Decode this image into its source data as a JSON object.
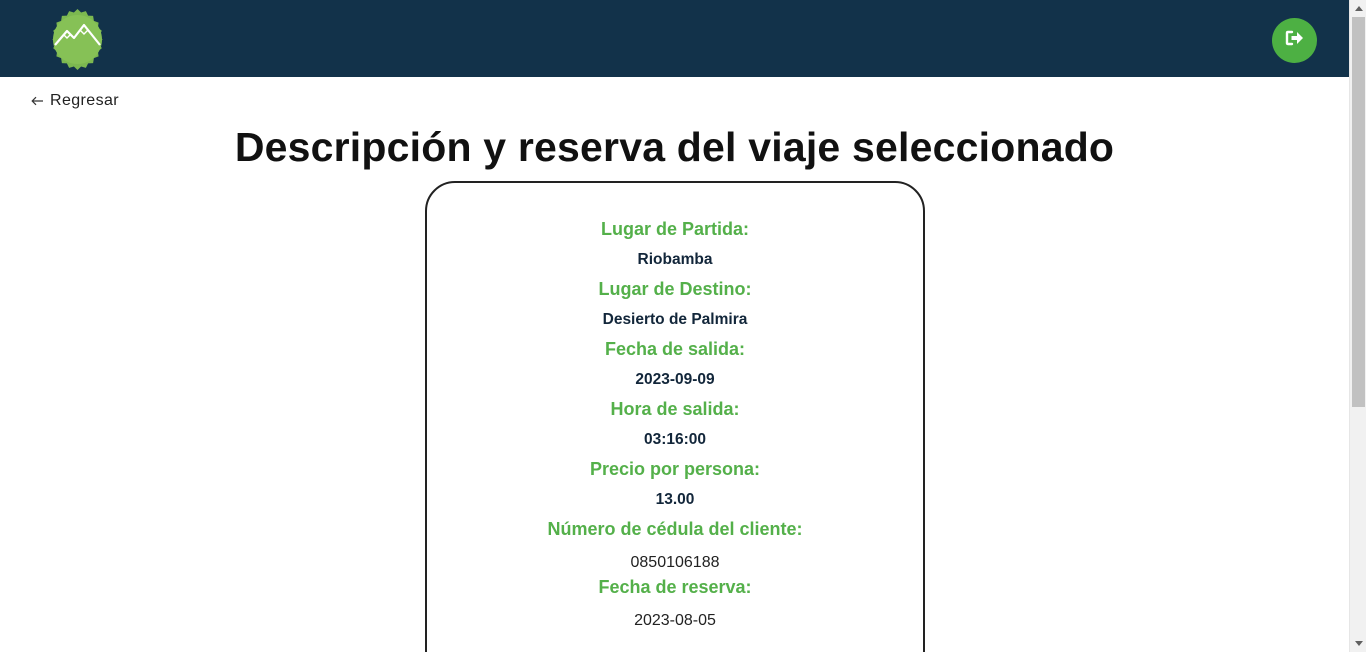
{
  "header": {
    "logo_icon": "mountain-badge-icon",
    "logout_icon": "sign-out-icon",
    "colors": {
      "bar": "#12324a",
      "accent": "#4db043"
    }
  },
  "nav": {
    "back_label": "Regresar",
    "back_icon": "arrow-left-icon"
  },
  "page": {
    "title": "Descripción y reserva del viaje seleccionado"
  },
  "trip": {
    "departure_label": "Lugar de Partida:",
    "departure_value": "Riobamba",
    "destination_label": "Lugar de Destino:",
    "destination_value": "Desierto de Palmira",
    "date_label": "Fecha de salida:",
    "date_value": "2023-09-09",
    "time_label": "Hora de salida:",
    "time_value": "03:16:00",
    "price_label": "Precio por persona:",
    "price_value": "13.00",
    "client_id_label": "Número de cédula del cliente:",
    "client_id_value": "0850106188",
    "reservation_date_label": "Fecha de reserva:",
    "reservation_date_value": "2023-08-05"
  }
}
